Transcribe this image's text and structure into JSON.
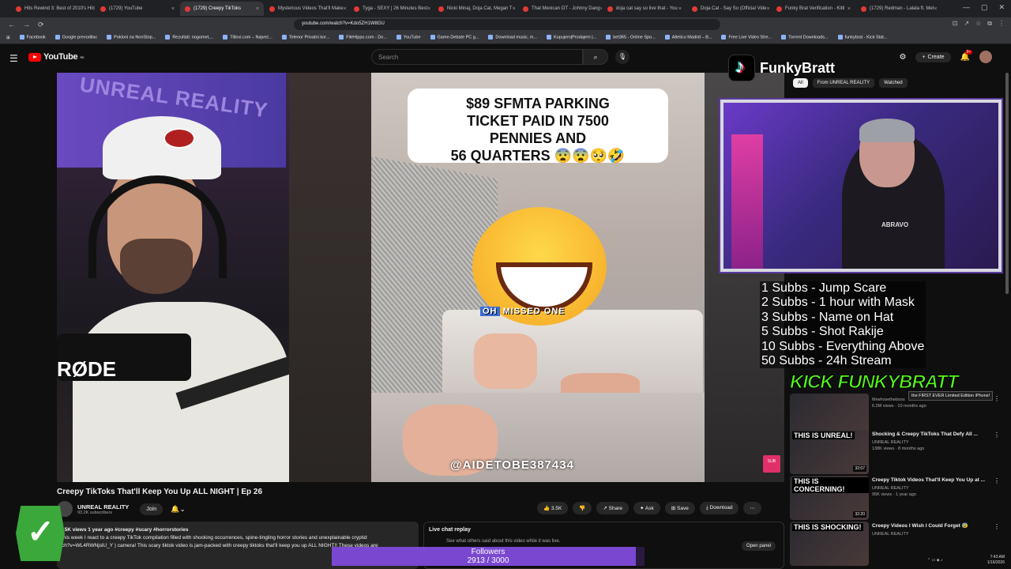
{
  "browser": {
    "tabs": [
      {
        "title": "Hits Rewind 3: Best of 2010's Hits",
        "active": false
      },
      {
        "title": "(1729) YouTube",
        "active": false
      },
      {
        "title": "(1729) Creepy TikToks",
        "active": true
      },
      {
        "title": "Mysterious Videos That'll Make",
        "active": false
      },
      {
        "title": "Tyga - SEXY | 26 Minutes Best",
        "active": false
      },
      {
        "title": "Nicki Minaj, Doja Cat, Megan T",
        "active": false
      },
      {
        "title": "That Mexican OT - Johnny Dang",
        "active": false
      },
      {
        "title": "doja cat say so live that - You",
        "active": false
      },
      {
        "title": "Doja Cat - Say So (Official Vide",
        "active": false
      },
      {
        "title": "Funky Brat Verification - Kittl",
        "active": false
      },
      {
        "title": "(1729) Redman - Lalala ft. Met",
        "active": false
      }
    ],
    "url": "youtube.com/watch?v=Kdo5ZH1W8GU",
    "bookmarks": [
      "Facebook",
      "Google prevodilac",
      "Pokloni na NonStop...",
      "Rezultati: nogomet,...",
      "Titlovi.com – Najveć...",
      "Telenor Privatni kor...",
      "FileHippo.com - Do...",
      "YouTube",
      "Game-Debate PC g...",
      "Download music, m...",
      "Kupujem|Prodajem |...",
      "bet365 - Online Spo...",
      "Atletico Madrid – B...",
      "Free Live Video Stre...",
      "Torrent Downloads...",
      "funkybrat - Kick Stat..."
    ]
  },
  "youtube": {
    "logo": "YouTube",
    "region": "RS",
    "search_placeholder": "Search",
    "create_label": "Create",
    "notif_count": "9+",
    "filter_chips": [
      "All",
      "From UNREAL REALITY",
      "Watched"
    ]
  },
  "video": {
    "title": "Creepy TikToks That'll Keep You Up ALL NIGHT | Ep 26",
    "channel": "UNREAL REALITY",
    "subs": "93.2K subscribers",
    "join_label": "Join",
    "likes": "3.5K",
    "actions": [
      "Share",
      "Ask",
      "Save",
      "Download"
    ],
    "views_line": "15K views  1 year ago  #creepy #scary #horrorstories",
    "desc1": "this week I react to a creepy TikTok compilation filled with shocking occurrences, spine-tingling horror stories and unexplainable cryptid",
    "desc2": "ch?v=WL4RWNjslU_Y ) camera! This scary tiktok video is jam-packed with creepy tiktoks that'll keep you up ALL NIGHT!! These videos are",
    "overlay": {
      "caption_line1": "$89 SFMTA PARKING",
      "caption_line2": "TICKET PAID IN 7500",
      "caption_line3": "PENNIES AND",
      "caption_line4": "56 QUARTERS",
      "sub_oh": "OH",
      "sub_missed": "MISSED ONE",
      "handle": "@AIDETOBE387434",
      "watermark": "UNREAL REALITY",
      "mic_brand": "RØDE"
    }
  },
  "chat": {
    "title": "Live chat replay",
    "subtitle": "See what others said about this video while it was live.",
    "open_panel": "Open panel"
  },
  "stream": {
    "tiktok_name": "FunkyBratt",
    "webcam_shirt": "ABRAVO",
    "goals": [
      "1 Subbs - Jump Scare",
      "2 Subbs - 1 hour with Mask",
      "3 Subbs - Name on Hat",
      "5 Subbs - Shot Rakije",
      "10 Subbs - Everything Above",
      "50 Subbs - 24h Stream"
    ],
    "kick_text": "KICK FUNKYBRATT",
    "followers_label": "Followers",
    "followers_count": "2913 / 3000",
    "followers_fraction": 0.971
  },
  "sidebar_recs": [
    {
      "thumb_text": "",
      "duration": "",
      "title": "the FIRST EVER Limited Edition iPhone!",
      "channel": "Mrwhosetheboss",
      "meta": "6.2M views · 10 months ago"
    },
    {
      "thumb_text": "THIS IS UNREAL!",
      "duration": "32:07",
      "title": "Shocking & Creepy TikToks That Defy All ...",
      "channel": "UNREAL REALITY",
      "meta": "138K views · 8 months ago"
    },
    {
      "thumb_text": "THIS IS CONCERNING!",
      "duration": "32:20",
      "title": "Creepy Tiktok Videos That'll Keep You Up at ...",
      "channel": "UNREAL REALITY",
      "meta": "95K views · 1 year ago"
    },
    {
      "thumb_text": "THIS IS SHOCKING!",
      "duration": "",
      "title": "Creepy Videos I Wish I Could Forget 😰",
      "channel": "UNREAL REALITY",
      "meta": ""
    }
  ],
  "system": {
    "time": "7:43 AM",
    "date": "1/16/2026"
  }
}
